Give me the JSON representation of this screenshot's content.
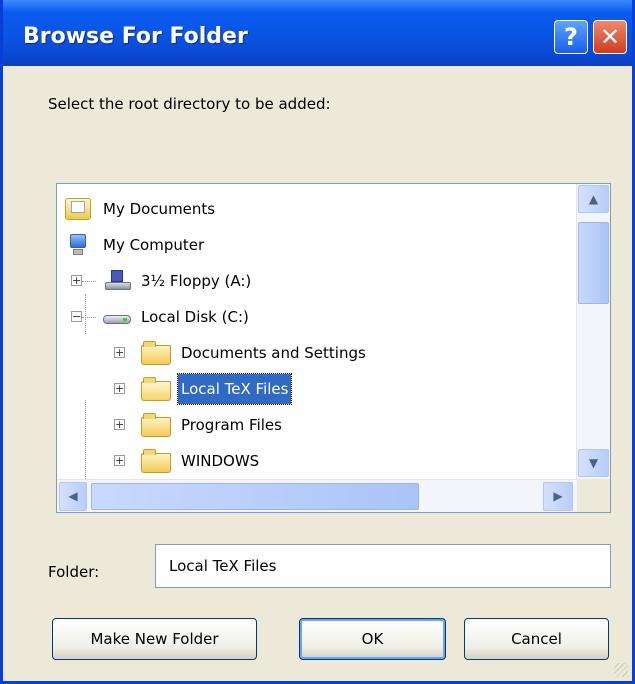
{
  "window": {
    "title": "Browse For Folder",
    "help_glyph": "?",
    "close_glyph": "✕"
  },
  "dialog": {
    "prompt": "Select the root directory to be added:"
  },
  "tree": {
    "items": [
      {
        "label": "My Documents",
        "icon": "documents-folder-icon"
      },
      {
        "label": "My Computer",
        "icon": "computer-icon"
      },
      {
        "label": "3½ Floppy (A:)",
        "icon": "floppy-drive-icon",
        "expander": "+"
      },
      {
        "label": "Local Disk (C:)",
        "icon": "hard-disk-icon",
        "expander": "−"
      },
      {
        "label": "Documents and Settings",
        "icon": "folder-icon",
        "expander": "+"
      },
      {
        "label": "Local TeX Files",
        "icon": "folder-icon",
        "expander": "+",
        "selected": true
      },
      {
        "label": "Program Files",
        "icon": "folder-icon",
        "expander": "+"
      },
      {
        "label": "WINDOWS",
        "icon": "folder-icon",
        "expander": "+"
      }
    ],
    "scroll": {
      "up_glyph": "▲",
      "down_glyph": "▼",
      "left_glyph": "◀",
      "right_glyph": "▶"
    }
  },
  "folder_field": {
    "label": "Folder:",
    "value": "Local TeX Files"
  },
  "buttons": {
    "make_new_folder": "Make New Folder",
    "ok": "OK",
    "cancel": "Cancel"
  },
  "colors": {
    "titlebar": "#0a54e3",
    "selection": "#316ac5",
    "dialog_bg": "#ece9d8"
  }
}
